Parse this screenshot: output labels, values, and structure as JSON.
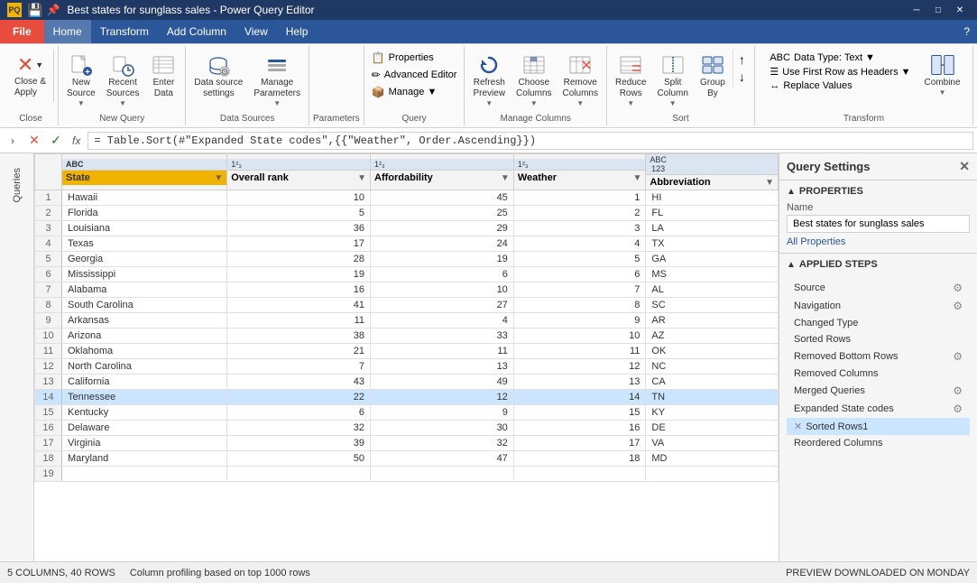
{
  "titleBar": {
    "icon": "PQ",
    "title": "Best states for sunglass sales - Power Query Editor",
    "saveBtn": "💾",
    "minBtn": "─",
    "maxBtn": "□",
    "closeBtn": "✕"
  },
  "menuBar": {
    "file": "File",
    "items": [
      "Home",
      "Transform",
      "Add Column",
      "View",
      "Help"
    ],
    "helpIcon": "?"
  },
  "ribbon": {
    "groups": [
      {
        "label": "Close",
        "items": [
          {
            "label": "Close &\nApply",
            "icon": "close-apply"
          }
        ]
      },
      {
        "label": "New Query",
        "items": [
          {
            "label": "New\nSource",
            "icon": "📄"
          },
          {
            "label": "Recent\nSources",
            "icon": "🕐"
          },
          {
            "label": "Enter\nData",
            "icon": "📝"
          }
        ]
      },
      {
        "label": "Data Sources",
        "items": [
          {
            "label": "Data source\nsettings",
            "icon": "🔌"
          },
          {
            "label": "Manage\nParameters",
            "icon": "⚙"
          }
        ]
      },
      {
        "label": "Parameters",
        "items": []
      },
      {
        "label": "Query",
        "items": [
          {
            "label": "Properties",
            "icon": "📋"
          },
          {
            "label": "Advanced Editor",
            "icon": "✏"
          },
          {
            "label": "Manage",
            "icon": "📦"
          }
        ]
      },
      {
        "label": "Query",
        "items": [
          {
            "label": "Refresh\nPreview",
            "icon": "🔄"
          },
          {
            "label": "Choose\nColumns",
            "icon": "▦"
          },
          {
            "label": "Remove\nColumns",
            "icon": "✂"
          },
          {
            "label": "Reduce\nRows",
            "icon": "≡"
          },
          {
            "label": "Split\nColumn",
            "icon": "⫛"
          },
          {
            "label": "Group\nBy",
            "icon": "⊞"
          }
        ]
      },
      {
        "label": "Manage Columns",
        "items": []
      },
      {
        "label": "Sort",
        "items": []
      },
      {
        "label": "Transform",
        "dataTypeLabel": "Data Type: Text",
        "useFirstRow": "Use First Row as Headers",
        "replaceValues": "Replace Values",
        "items": [
          {
            "label": "Combine",
            "icon": "🔗"
          }
        ]
      }
    ]
  },
  "formulaBar": {
    "formula": "= Table.Sort(#\"Expanded State codes\",{{\"Weather\", Order.Ascending}})"
  },
  "queriesPanel": {
    "label": "Queries"
  },
  "table": {
    "columns": [
      {
        "name": "State",
        "type": "ABC",
        "typeIcon": "ABC",
        "highlighted": true
      },
      {
        "name": "Overall rank",
        "type": "123",
        "typeIcon": "123",
        "highlighted": false
      },
      {
        "name": "Affordability",
        "type": "123",
        "typeIcon": "123",
        "highlighted": false
      },
      {
        "name": "Weather",
        "type": "123",
        "typeIcon": "123",
        "highlighted": false
      },
      {
        "name": "Abbreviation",
        "type": "ABC\n123",
        "typeIcon": "ABC",
        "highlighted": false
      }
    ],
    "rows": [
      {
        "num": 1,
        "state": "Hawaii",
        "overall": 10,
        "afford": 45,
        "weather": 1,
        "abbr": "HI"
      },
      {
        "num": 2,
        "state": "Florida",
        "overall": 5,
        "afford": 25,
        "weather": 2,
        "abbr": "FL"
      },
      {
        "num": 3,
        "state": "Louisiana",
        "overall": 36,
        "afford": 29,
        "weather": 3,
        "abbr": "LA"
      },
      {
        "num": 4,
        "state": "Texas",
        "overall": 17,
        "afford": 24,
        "weather": 4,
        "abbr": "TX"
      },
      {
        "num": 5,
        "state": "Georgia",
        "overall": 28,
        "afford": 19,
        "weather": 5,
        "abbr": "GA"
      },
      {
        "num": 6,
        "state": "Mississippi",
        "overall": 19,
        "afford": 6,
        "weather": 6,
        "abbr": "MS"
      },
      {
        "num": 7,
        "state": "Alabama",
        "overall": 16,
        "afford": 10,
        "weather": 7,
        "abbr": "AL"
      },
      {
        "num": 8,
        "state": "South Carolina",
        "overall": 41,
        "afford": 27,
        "weather": 8,
        "abbr": "SC"
      },
      {
        "num": 9,
        "state": "Arkansas",
        "overall": 11,
        "afford": 4,
        "weather": 9,
        "abbr": "AR"
      },
      {
        "num": 10,
        "state": "Arizona",
        "overall": 38,
        "afford": 33,
        "weather": 10,
        "abbr": "AZ"
      },
      {
        "num": 11,
        "state": "Oklahoma",
        "overall": 21,
        "afford": 11,
        "weather": 11,
        "abbr": "OK"
      },
      {
        "num": 12,
        "state": "North Carolina",
        "overall": 7,
        "afford": 13,
        "weather": 12,
        "abbr": "NC"
      },
      {
        "num": 13,
        "state": "California",
        "overall": 43,
        "afford": 49,
        "weather": 13,
        "abbr": "CA"
      },
      {
        "num": 14,
        "state": "Tennessee",
        "overall": 22,
        "afford": 12,
        "weather": 14,
        "abbr": "TN",
        "highlighted": true
      },
      {
        "num": 15,
        "state": "Kentucky",
        "overall": 6,
        "afford": 9,
        "weather": 15,
        "abbr": "KY"
      },
      {
        "num": 16,
        "state": "Delaware",
        "overall": 32,
        "afford": 30,
        "weather": 16,
        "abbr": "DE"
      },
      {
        "num": 17,
        "state": "Virginia",
        "overall": 39,
        "afford": 32,
        "weather": 17,
        "abbr": "VA"
      },
      {
        "num": 18,
        "state": "Maryland",
        "overall": 50,
        "afford": 47,
        "weather": 18,
        "abbr": "MD"
      },
      {
        "num": 19,
        "state": "",
        "overall": "",
        "afford": "",
        "weather": "",
        "abbr": ""
      }
    ]
  },
  "querySettings": {
    "title": "Query Settings",
    "propertiesLabel": "PROPERTIES",
    "nameLabel": "Name",
    "nameValue": "Best states for sunglass sales",
    "allPropertiesLink": "All Properties",
    "appliedStepsLabel": "APPLIED STEPS",
    "steps": [
      {
        "label": "Source",
        "hasGear": true,
        "hasX": false,
        "active": false
      },
      {
        "label": "Navigation",
        "hasGear": true,
        "hasX": false,
        "active": false
      },
      {
        "label": "Changed Type",
        "hasGear": false,
        "hasX": false,
        "active": false
      },
      {
        "label": "Sorted Rows",
        "hasGear": false,
        "hasX": false,
        "active": false
      },
      {
        "label": "Removed Bottom Rows",
        "hasGear": true,
        "hasX": false,
        "active": false
      },
      {
        "label": "Removed Columns",
        "hasGear": false,
        "hasX": false,
        "active": false
      },
      {
        "label": "Merged Queries",
        "hasGear": true,
        "hasX": false,
        "active": false
      },
      {
        "label": "Expanded State codes",
        "hasGear": true,
        "hasX": false,
        "active": false
      },
      {
        "label": "Sorted Rows1",
        "hasGear": false,
        "hasX": true,
        "active": true
      },
      {
        "label": "Reordered Columns",
        "hasGear": false,
        "hasX": false,
        "active": false
      }
    ]
  },
  "statusBar": {
    "info": "5 COLUMNS, 40 ROWS",
    "profiling": "Column profiling based on top 1000 rows",
    "previewInfo": "PREVIEW DOWNLOADED ON MONDAY"
  }
}
